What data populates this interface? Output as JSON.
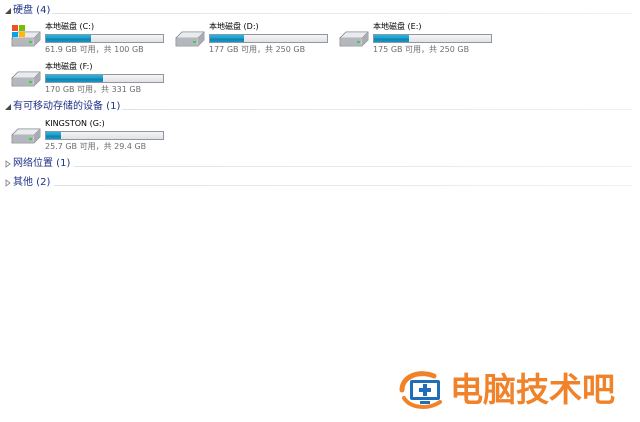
{
  "groups": {
    "hard_disks": {
      "title": "硬盘 (4)"
    },
    "removable": {
      "title": "有可移动存储的设备 (1)"
    },
    "network": {
      "title": "网络位置 (1)"
    },
    "other": {
      "title": "其他 (2)"
    }
  },
  "drives": [
    {
      "name": "本地磁盘 (C:)",
      "info": "61.9 GB 可用，共 100 GB",
      "used_fraction": 0.381,
      "icon": "system-drive-icon"
    },
    {
      "name": "本地磁盘 (D:)",
      "info": "177 GB 可用，共 250 GB",
      "used_fraction": 0.292,
      "icon": "hard-drive-icon"
    },
    {
      "name": "本地磁盘 (E:)",
      "info": "175 GB 可用，共 250 GB",
      "used_fraction": 0.3,
      "icon": "hard-drive-icon"
    },
    {
      "name": "本地磁盘 (F:)",
      "info": "170 GB 可用，共 331 GB",
      "used_fraction": 0.486,
      "icon": "hard-drive-icon"
    },
    {
      "name": "KINGSTON (G:)",
      "info": "25.7 GB 可用，共 29.4 GB",
      "used_fraction": 0.126,
      "icon": "usb-drive-icon"
    }
  ],
  "watermark": {
    "text": "电脑技术吧",
    "icon": "monitor-plus-logo"
  },
  "colors": {
    "group_title": "#1e3287",
    "bar_fill": "#1ca0cd",
    "info_text": "#6d6d6d",
    "watermark": "#f0822a"
  }
}
